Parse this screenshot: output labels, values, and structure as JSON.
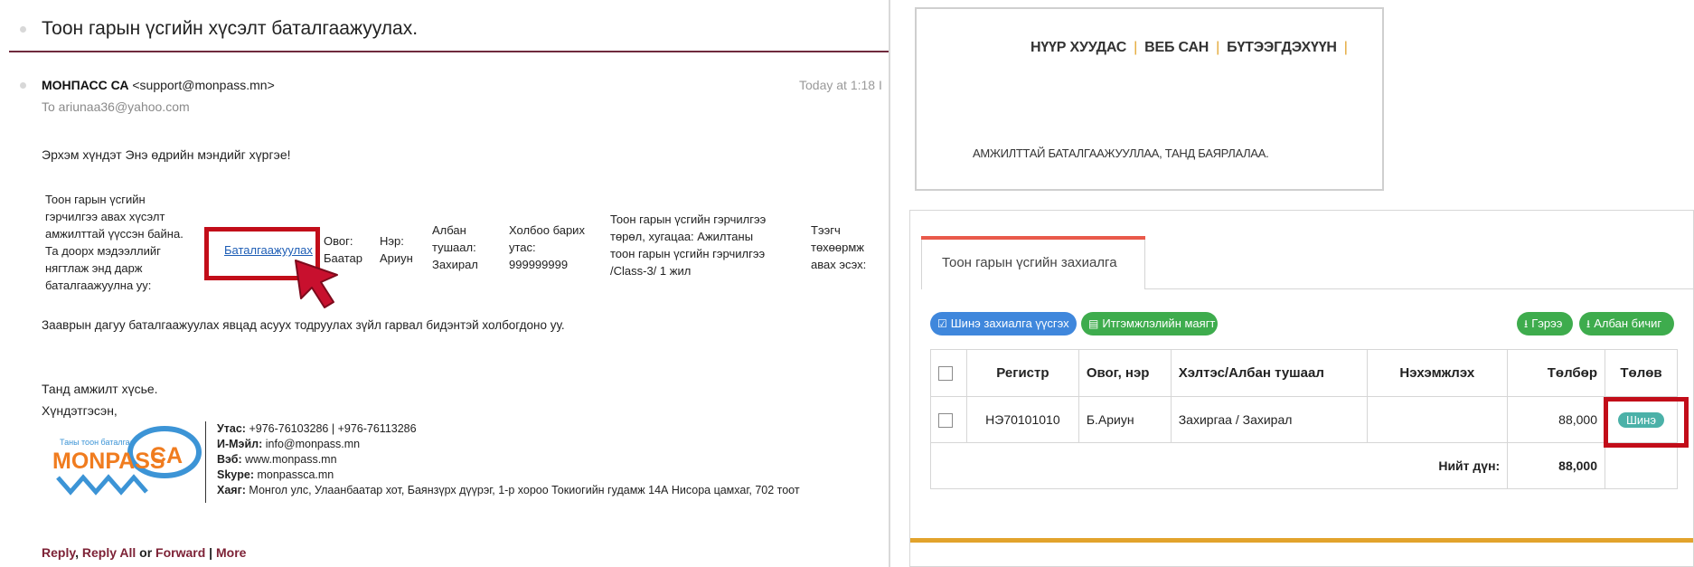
{
  "email": {
    "subject": "Тоон гарын үсгийн хүсэлт баталгаажуулах.",
    "from_name": "МОНПАСС СА",
    "from_email": "<support@monpass.mn>",
    "date": "Today at 1:18 I",
    "to": "To  ariunaa36@yahoo.com",
    "greeting": "Эрхэм хүндэт Энэ өдрийн мэндийг хүргэе!",
    "intro_text": "Тоон гарын үсгийн\nгэрчилгээ авах хүсэлт\nамжилттай үүссэн байна.\nТа доорх мэдээллийг\nнягтлаж энд дарж\nбаталгаажуулна уу:",
    "confirm_link": "Баталгаажуулах",
    "col_surname": "Овог:\nБаатар",
    "col_name": "Нэр:\nАриун",
    "col_position": "Албан\nтушаал:\nЗахирал",
    "col_phone": "Холбоо барих\nутас:\n999999999",
    "col_type": "Тоон гарын үсгийн гэрчилгээ\nтөрөл, хугацаа: Ажилтаны\nтоон гарын үсгийн гэрчилгээ\n/Class-3/ 1 жил",
    "col_device": "Тээгч\nтөхөөрмж\nавах эсэх:",
    "followup": "Зааврын дагуу баталгаажуулах явцад асуух тодруулах зүйл гарвал бидэнтэй холбогдоно уу.",
    "closing1": "Танд амжилт хүсье.",
    "closing2": "Хүндэтгэсэн,",
    "signature": {
      "logo_tagline": "Таны тоон баталгаа",
      "logo_text": "MONPASS",
      "logo_badge": "CA",
      "phone_label": "Утас:",
      "phone": " +976-76103286 | +976-76113286",
      "email_label": "И-Мэйл:",
      "email": " info@monpass.mn",
      "web_label": "Вэб:",
      "web": " www.monpass.mn",
      "skype_label": "Skype:",
      "skype": " monpassca.mn",
      "address_label": "Хаяг:",
      "address": " Монгол улс, Улаанбаатар хот, Баянзүрх дүүрэг, 1-р хороо Токиогийн гудамж 14А Нисора цамхаг, 702 тоот"
    },
    "reply": "Reply",
    "reply_all": "Reply All",
    "or": "or",
    "forward": "Forward",
    "more": "More"
  },
  "site": {
    "nav_home": "НҮҮР ХУУДАС",
    "nav_web": "ВЕБ САН",
    "nav_register": "БҮТЭЭГДЭХҮҮН",
    "success_msg": "АМЖИЛТТАЙ БАТАЛГААЖУУЛЛАА, ТАНД БАЯРЛАЛАА."
  },
  "orders": {
    "tab": "Тоон гарын үсгийн захиалга",
    "btn_new": "Шинэ захиалга үүсгэх",
    "btn_trust": "Итгэмжлэлийн маягт",
    "btn_contract": "Гэрээ",
    "btn_letter": "Албан бичиг",
    "headers": {
      "register": "Регистр",
      "name": "Овог, нэр",
      "position": "Хэлтэс/Албан тушаал",
      "attachment": "Нэхэмжлэх",
      "fee": "Төлбөр",
      "status": "Төлөв"
    },
    "rows": [
      {
        "register": "НЭ70101010",
        "name": "Б.Ариун",
        "position": "Захиргаа / Захирал",
        "attachment": "",
        "fee": "88,000",
        "status": "Шинэ"
      }
    ],
    "total_label": "Нийт дүн:",
    "total": "88,000"
  },
  "colors": {
    "highlight": "#c20d19",
    "accent_orange": "#e2a32c",
    "tab_red": "#e9594a",
    "btn_blue": "#3f87dc",
    "btn_green": "#3eac4d",
    "status_teal": "#4bb1a8",
    "email_rule": "#6f2a3d",
    "link_blue": "#1d5db5"
  }
}
